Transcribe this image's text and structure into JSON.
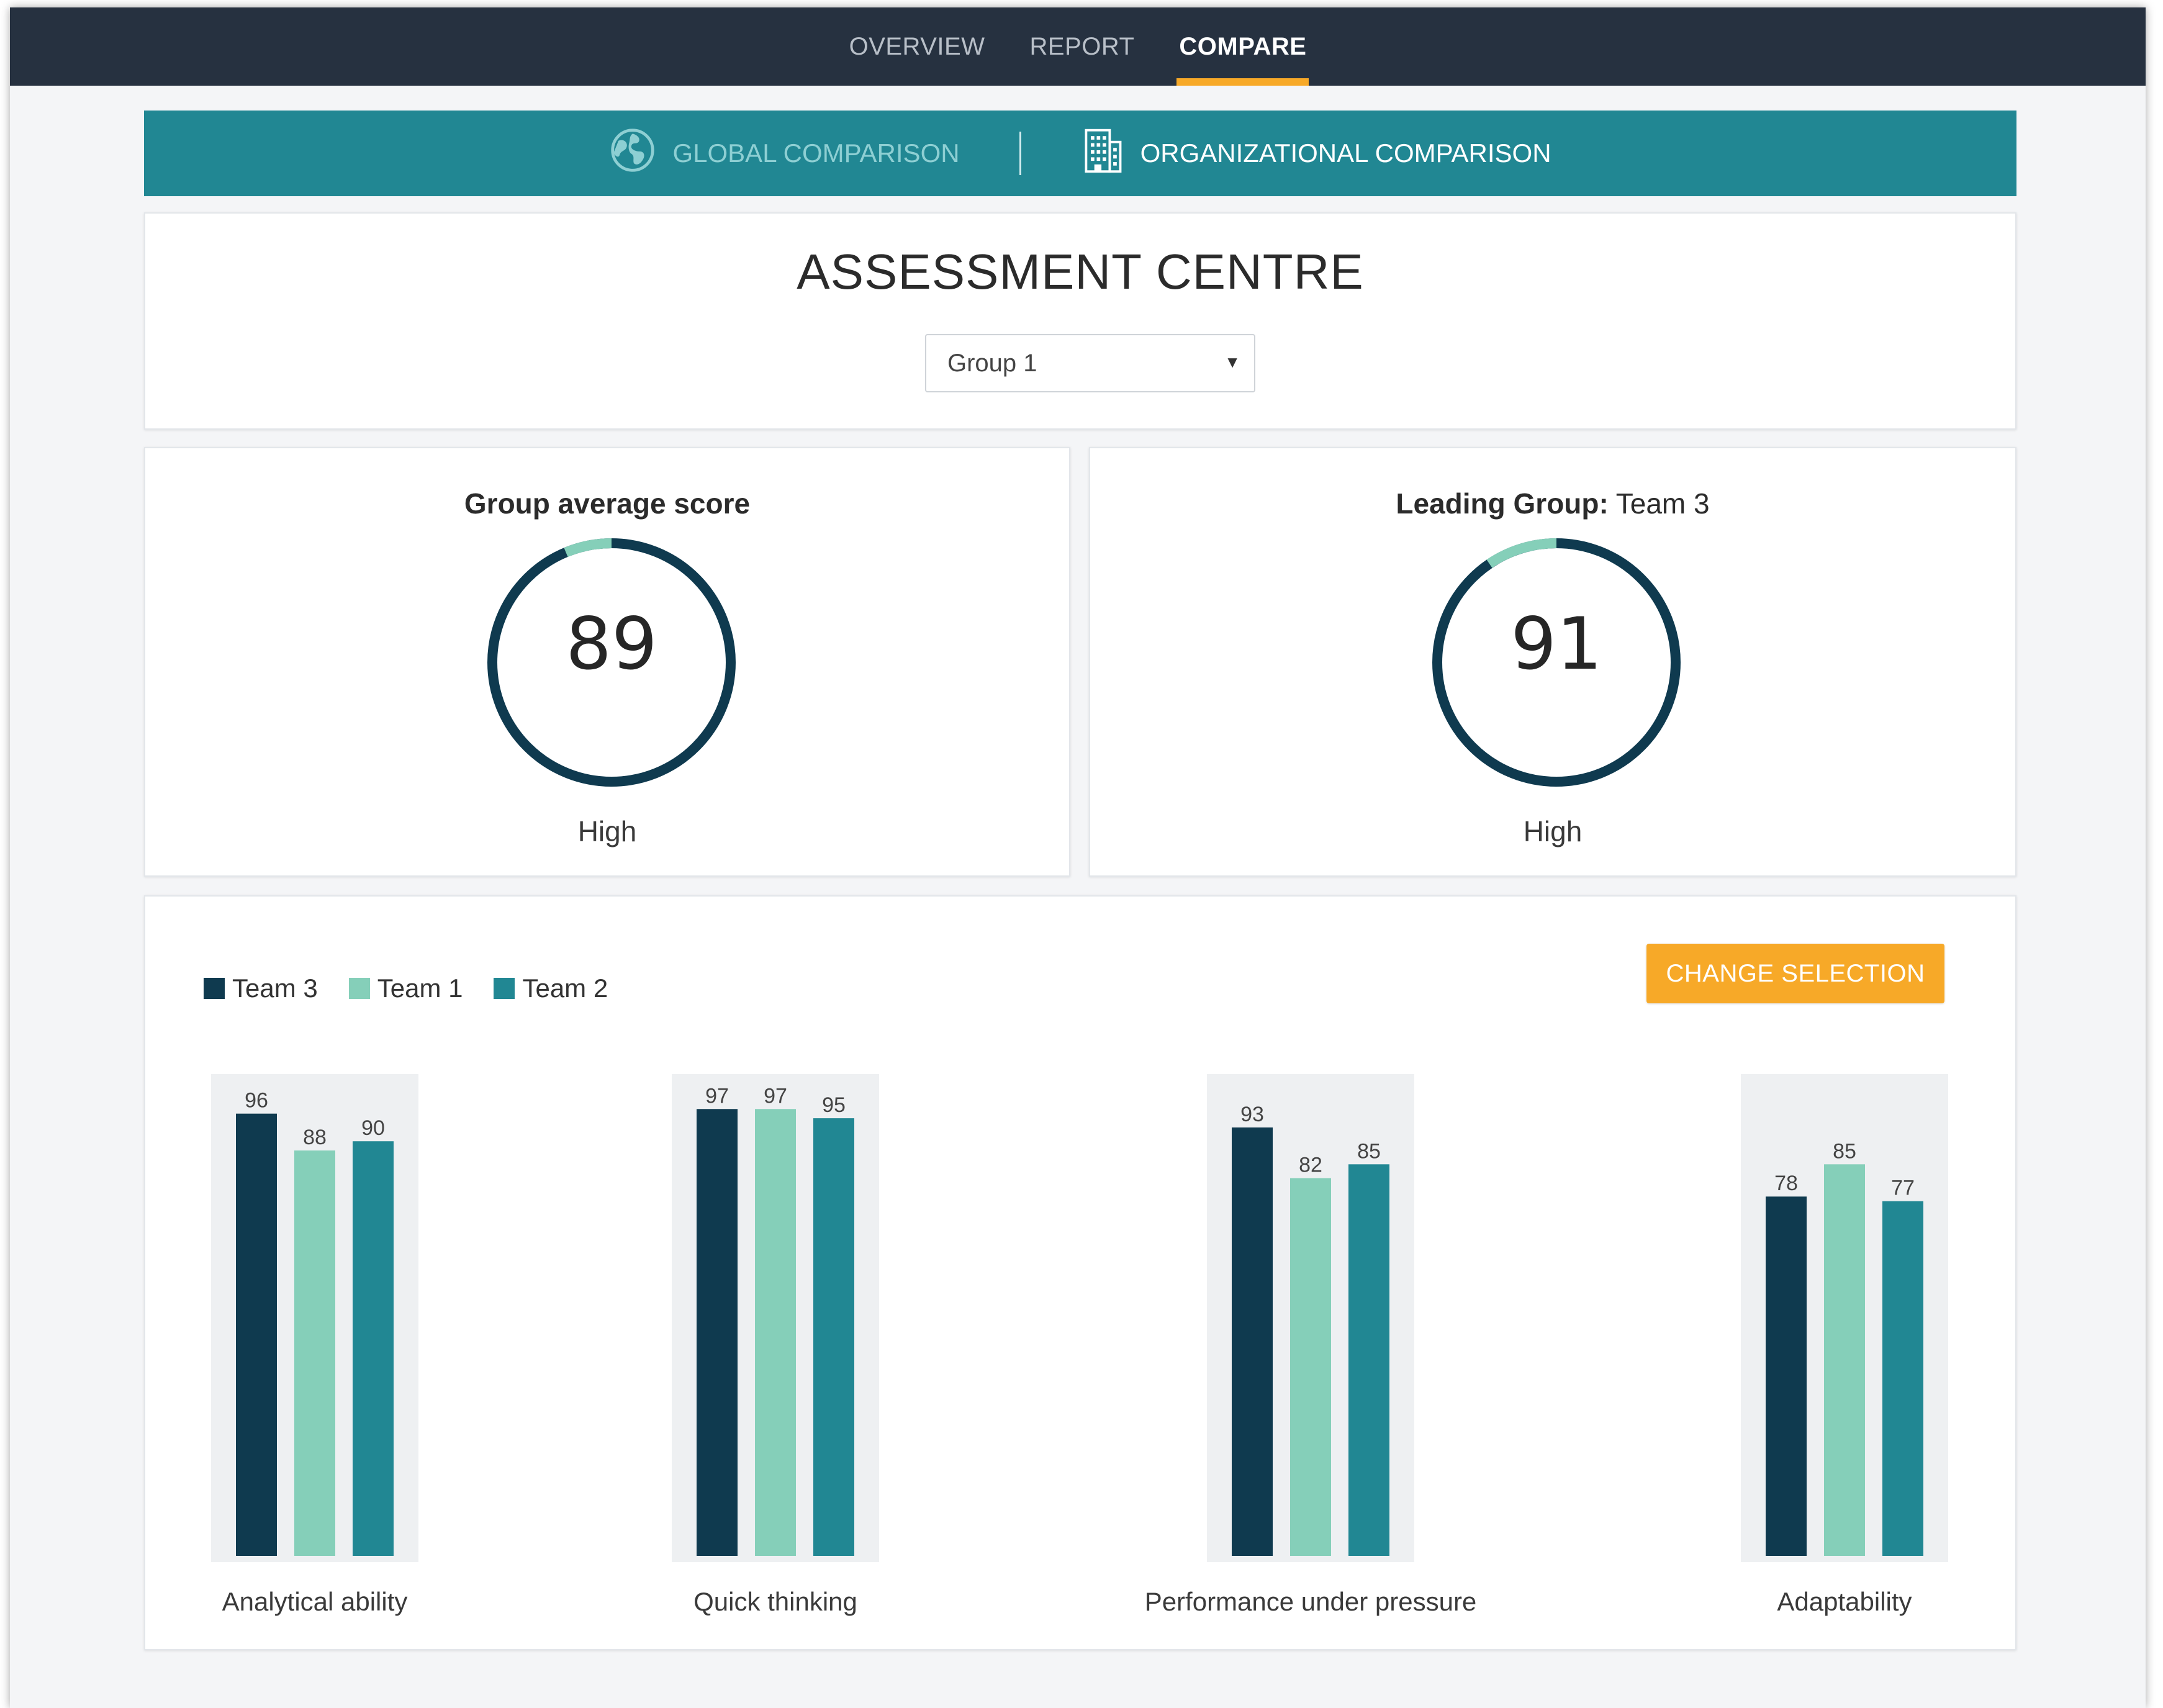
{
  "nav": {
    "items": [
      {
        "label": "OVERVIEW",
        "active": false
      },
      {
        "label": "REPORT",
        "active": false
      },
      {
        "label": "COMPARE",
        "active": true
      }
    ]
  },
  "subnav": {
    "global": {
      "label": "GLOBAL COMPARISON",
      "icon": "globe-icon"
    },
    "org": {
      "label": "ORGANIZATIONAL COMPARISON",
      "icon": "building-icon"
    }
  },
  "header": {
    "title": "ASSESSMENT CENTRE",
    "group_select": {
      "value": "Group 1"
    }
  },
  "scores": {
    "left": {
      "title": "Group average score",
      "value": "89",
      "level": "High"
    },
    "right": {
      "title_bold": "Leading Group:",
      "title_rest": " Team 3",
      "value": "91",
      "level": "High"
    }
  },
  "actions": {
    "change_selection": "CHANGE SELECTION"
  },
  "colors": {
    "navy": "#0f3a4f",
    "mint": "#85cfb9",
    "teal": "#218793",
    "accent": "#f7a928",
    "topbar": "#263140"
  },
  "chart_data": {
    "type": "bar",
    "categories": [
      "Analytical ability",
      "Quick thinking",
      "Performance under pressure",
      "Adaptability"
    ],
    "series": [
      {
        "name": "Team 3",
        "values": [
          96,
          97,
          93,
          78
        ],
        "color": "#0f3a4f"
      },
      {
        "name": "Team 1",
        "values": [
          88,
          97,
          82,
          85
        ],
        "color": "#85cfb9"
      },
      {
        "name": "Team 2",
        "values": [
          90,
          95,
          85,
          77
        ],
        "color": "#218793"
      }
    ],
    "ylim": [
      0,
      100
    ],
    "legend": "top-left",
    "grid": false
  }
}
